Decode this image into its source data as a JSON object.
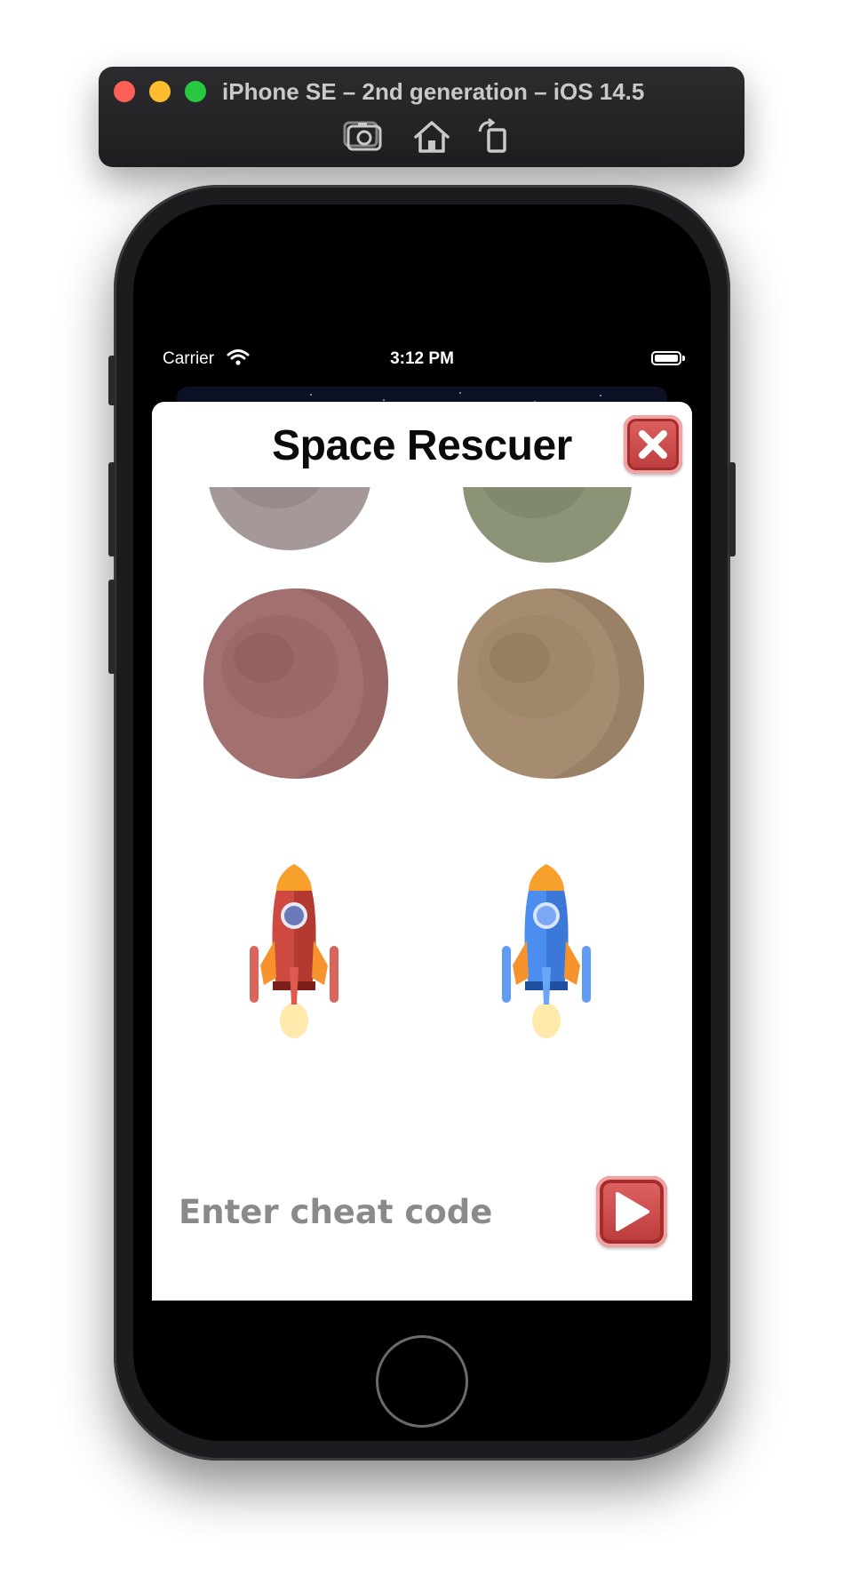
{
  "simulator": {
    "title": "iPhone SE – 2nd generation – iOS 14.5",
    "buttons": [
      "screenshot-icon",
      "home-icon",
      "rotate-icon"
    ]
  },
  "status_bar": {
    "carrier": "Carrier",
    "time": "3:12 PM"
  },
  "sheet": {
    "title": "Space Rescuer",
    "items": [
      {
        "name": "asteroid-gray",
        "color": "#a59898"
      },
      {
        "name": "asteroid-green",
        "color": "#8c9478"
      },
      {
        "name": "asteroid-red",
        "color": "#a2706e"
      },
      {
        "name": "asteroid-tan",
        "color": "#a58c70"
      },
      {
        "name": "rocket-red",
        "color": "#cc4a3f"
      },
      {
        "name": "rocket-blue",
        "color": "#4c8df0"
      }
    ],
    "cheat_placeholder": "Enter cheat code"
  },
  "colors": {
    "button_red": "#c64545",
    "placeholder_gray": "#8a8a8a"
  }
}
